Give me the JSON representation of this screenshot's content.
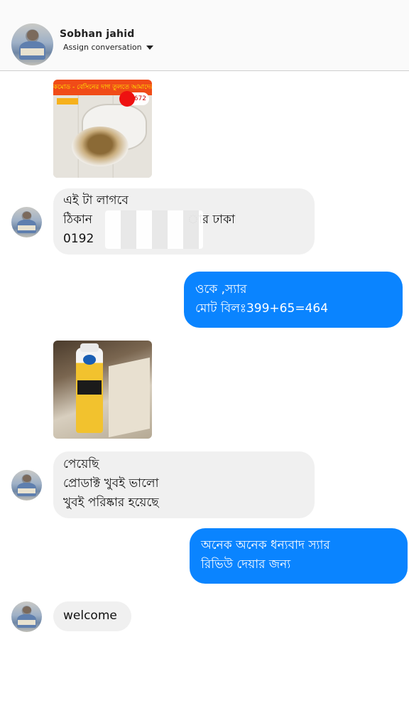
{
  "header": {
    "contact_name": "Sobhan jahid",
    "assign_label": "Assign conversation"
  },
  "messages": [
    {
      "type": "image",
      "direction": "incoming",
      "image_text": {
        "banner": "কমোড - বেসিনের দাগ তুলতে আমাদের",
        "phone": "01672"
      }
    },
    {
      "type": "text",
      "direction": "incoming",
      "lines": [
        "এই টা লাগবে",
        "ঠিকান",
        "ার ঢাকা",
        "0192"
      ]
    },
    {
      "type": "text",
      "direction": "outgoing",
      "lines": [
        "ওকে ,স্যার",
        "মোট বিলঃ399+65=464"
      ]
    },
    {
      "type": "image",
      "direction": "incoming"
    },
    {
      "type": "text",
      "direction": "incoming",
      "lines": [
        "পেয়েছি",
        "প্রোডাক্ট খুবই ভালো",
        "খুবই পরিষ্কার হয়েছে"
      ]
    },
    {
      "type": "text",
      "direction": "outgoing",
      "lines": [
        "অনেক অনেক ধন্যবাদ স্যার",
        "রিভিউ দেয়ার জন্য"
      ]
    },
    {
      "type": "text",
      "direction": "incoming",
      "lines": [
        "welcome"
      ]
    }
  ],
  "colors": {
    "outgoing_bubble": "#0a84ff",
    "incoming_bubble": "#f0f0f0"
  }
}
